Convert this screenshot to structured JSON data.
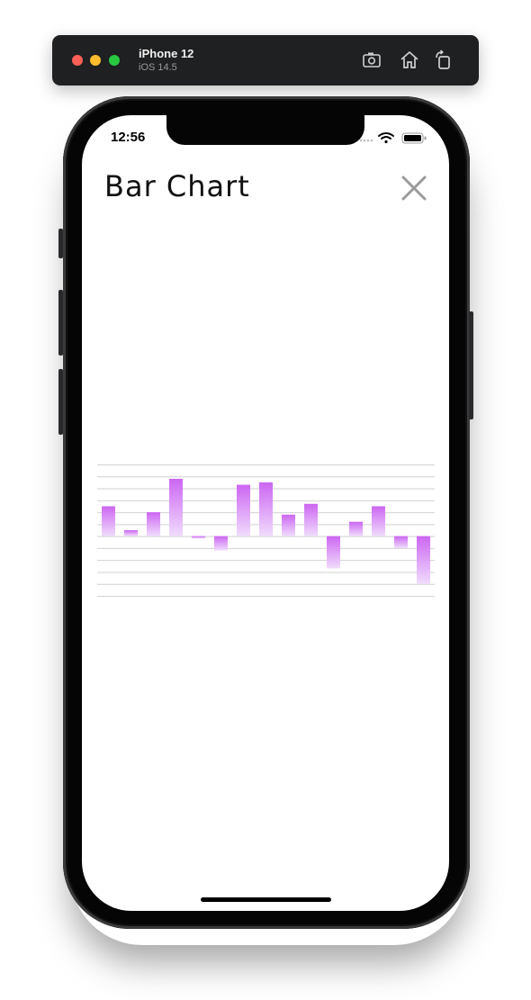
{
  "simulator": {
    "device": "iPhone 12",
    "os": "iOS 14.5",
    "buttons": [
      "screenshot-icon",
      "home-icon",
      "rotate-icon"
    ]
  },
  "status_bar": {
    "time": "12:56"
  },
  "nav": {
    "title": "Bar Chart",
    "close_icon": "close-icon"
  },
  "chart_data": {
    "type": "bar",
    "title": "",
    "xlabel": "",
    "ylabel": "",
    "ylim": [
      -50,
      60
    ],
    "grid": true,
    "legend": "none",
    "colors": {
      "top": "#cc66f2",
      "bottom": "#f0dcfc"
    },
    "values": [
      25,
      5,
      20,
      48,
      -2,
      -12,
      43,
      45,
      18,
      27,
      -27,
      12,
      25,
      -10,
      -40
    ]
  }
}
